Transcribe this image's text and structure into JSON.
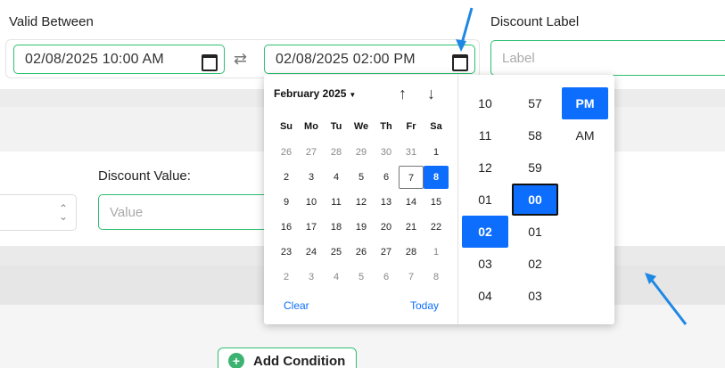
{
  "valid_between": {
    "label": "Valid Between",
    "start_value": "02/08/2025 10:00 AM",
    "end_value": "02/08/2025 02:00 PM"
  },
  "discount_label": {
    "label": "Discount Label",
    "placeholder": "Label"
  },
  "discount_value": {
    "label": "Discount Value:",
    "placeholder": "Value"
  },
  "add_condition": {
    "label": "Add Condition"
  },
  "picker": {
    "month_label": "February 2025",
    "weekdays": [
      "Su",
      "Mo",
      "Tu",
      "We",
      "Th",
      "Fr",
      "Sa"
    ],
    "weeks": [
      [
        "26",
        "27",
        "28",
        "29",
        "30",
        "31",
        "1"
      ],
      [
        "2",
        "3",
        "4",
        "5",
        "6",
        "7",
        "8"
      ],
      [
        "9",
        "10",
        "11",
        "12",
        "13",
        "14",
        "15"
      ],
      [
        "16",
        "17",
        "18",
        "19",
        "20",
        "21",
        "22"
      ],
      [
        "23",
        "24",
        "25",
        "26",
        "27",
        "28",
        "1"
      ],
      [
        "2",
        "3",
        "4",
        "5",
        "6",
        "7",
        "8"
      ]
    ],
    "today_day": "7",
    "selected_day": "8",
    "clear_label": "Clear",
    "today_label": "Today",
    "hours": [
      "10",
      "11",
      "12",
      "01",
      "02",
      "03",
      "04"
    ],
    "selected_hour": "02",
    "minutes": [
      "57",
      "58",
      "59",
      "00",
      "01",
      "02",
      "03"
    ],
    "selected_minute": "00",
    "periods": [
      "PM",
      "AM"
    ],
    "selected_period": "PM"
  },
  "colors": {
    "accent_blue": "#0d6efd",
    "field_border_green": "#2fbf71",
    "annotation_arrow": "#1e88e5"
  }
}
